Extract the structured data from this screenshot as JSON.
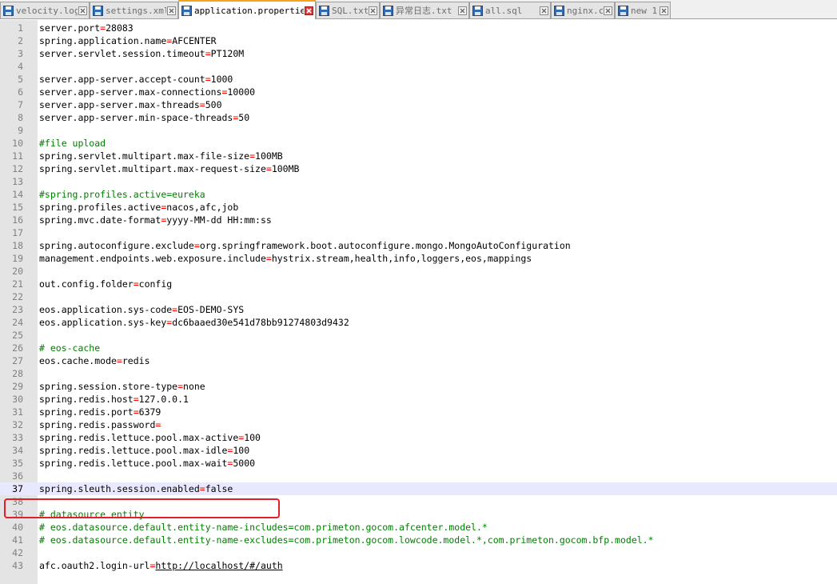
{
  "tabs": [
    {
      "label": "velocity.log",
      "icon": "save-icon",
      "active": false
    },
    {
      "label": "settings.xml",
      "icon": "save-icon",
      "active": false
    },
    {
      "label": "application.properties",
      "icon": "save-icon",
      "active": true
    },
    {
      "label": "SQL.txt",
      "icon": "save-icon",
      "active": false
    },
    {
      "label": "异常日志.txt",
      "icon": "save-icon",
      "active": false
    },
    {
      "label": "all.sql",
      "icon": "save-icon",
      "active": false
    },
    {
      "label": "nginx.conf",
      "icon": "save-icon",
      "active": false
    },
    {
      "label": "new 1",
      "icon": "save-icon",
      "active": false
    }
  ],
  "editor": {
    "current_line": 37,
    "lines": [
      {
        "num": "1",
        "key": "server.port",
        "value": "28083"
      },
      {
        "num": "2",
        "key": "spring.application.name",
        "value": "AFCENTER"
      },
      {
        "num": "3",
        "key": "server.servlet.session.timeout",
        "value": "PT120M"
      },
      {
        "num": "4"
      },
      {
        "num": "5",
        "key": "server.app-server.accept-count",
        "value": "1000"
      },
      {
        "num": "6",
        "key": "server.app-server.max-connections",
        "value": "10000"
      },
      {
        "num": "7",
        "key": "server.app-server.max-threads",
        "value": "500"
      },
      {
        "num": "8",
        "key": "server.app-server.min-space-threads",
        "value": "50"
      },
      {
        "num": "9"
      },
      {
        "num": "10",
        "comment": "#file upload"
      },
      {
        "num": "11",
        "key": "spring.servlet.multipart.max-file-size",
        "value": "100MB"
      },
      {
        "num": "12",
        "key": "spring.servlet.multipart.max-request-size",
        "value": "100MB"
      },
      {
        "num": "13"
      },
      {
        "num": "14",
        "comment": "#spring.profiles.active=eureka"
      },
      {
        "num": "15",
        "key": "spring.profiles.active",
        "value": "nacos,afc,job"
      },
      {
        "num": "16",
        "key": "spring.mvc.date-format",
        "value": "yyyy-MM-dd HH:mm:ss"
      },
      {
        "num": "17"
      },
      {
        "num": "18",
        "key": "spring.autoconfigure.exclude",
        "value": "org.springframework.boot.autoconfigure.mongo.MongoAutoConfiguration"
      },
      {
        "num": "19",
        "key": "management.endpoints.web.exposure.include",
        "value": "hystrix.stream,health,info,loggers,eos,mappings"
      },
      {
        "num": "20"
      },
      {
        "num": "21",
        "key": "out.config.folder",
        "value": "config"
      },
      {
        "num": "22"
      },
      {
        "num": "23",
        "key": "eos.application.sys-code",
        "value": "EOS-DEMO-SYS"
      },
      {
        "num": "24",
        "key": "eos.application.sys-key",
        "value": "dc6baaed30e541d78bb91274803d9432"
      },
      {
        "num": "25"
      },
      {
        "num": "26",
        "comment": "# eos-cache"
      },
      {
        "num": "27",
        "key": "eos.cache.mode",
        "value": "redis"
      },
      {
        "num": "28"
      },
      {
        "num": "29",
        "key": "spring.session.store-type",
        "value": "none"
      },
      {
        "num": "30",
        "key": "spring.redis.host",
        "value": "127.0.0.1"
      },
      {
        "num": "31",
        "key": "spring.redis.port",
        "value": "6379"
      },
      {
        "num": "32",
        "key": "spring.redis.password",
        "value": ""
      },
      {
        "num": "33",
        "key": "spring.redis.lettuce.pool.max-active",
        "value": "100"
      },
      {
        "num": "34",
        "key": "spring.redis.lettuce.pool.max-idle",
        "value": "100"
      },
      {
        "num": "35",
        "key": "spring.redis.lettuce.pool.max-wait",
        "value": "5000"
      },
      {
        "num": "36"
      },
      {
        "num": "37",
        "key": "spring.sleuth.session.enabled",
        "value": "false"
      },
      {
        "num": "38"
      },
      {
        "num": "39",
        "comment": "# datasource entity"
      },
      {
        "num": "40",
        "comment": "# eos.datasource.default.entity-name-includes=com.primeton.gocom.afcenter.model.*"
      },
      {
        "num": "41",
        "comment": "# eos.datasource.default.entity-name-excludes=com.primeton.gocom.lowcode.model.*,com.primeton.gocom.bfp.model.*"
      },
      {
        "num": "42"
      },
      {
        "num": "43",
        "key": "afc.oauth2.login-url",
        "value": "http://localhost/#/auth",
        "link": true
      }
    ]
  }
}
